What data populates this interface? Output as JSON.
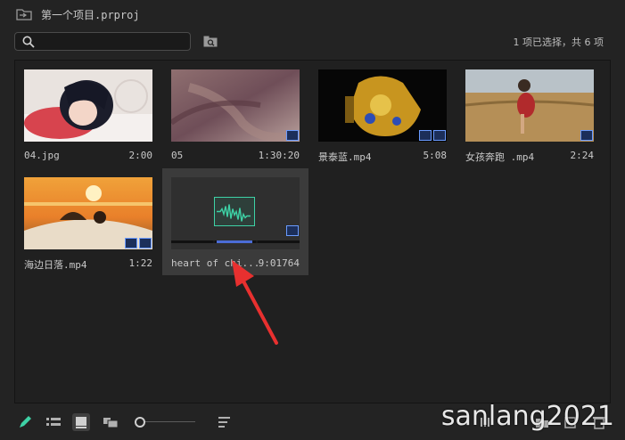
{
  "project": {
    "title": "第一个项目.prproj"
  },
  "search": {
    "placeholder": ""
  },
  "status": {
    "selection": "1 项已选择，共 6 项"
  },
  "items": [
    {
      "name": "04.jpg",
      "duration": "2:00"
    },
    {
      "name": "05",
      "duration": "1:30:20"
    },
    {
      "name": "景泰蓝.mp4",
      "duration": "5:08"
    },
    {
      "name": "女孩奔跑 .mp4",
      "duration": "2:24"
    },
    {
      "name": "海边日落.mp4",
      "duration": "1:22"
    },
    {
      "name": "heart of chi...",
      "duration": "9:01764",
      "selected": true,
      "playhead_progress": 0.63
    }
  ],
  "toolbar": {
    "icons": [
      "pencil-icon",
      "list-view-icon",
      "icon-view-icon",
      "freeform-view-icon",
      "zoom-slider",
      "sort-icon",
      "automate-to-sequence-icon",
      "find-icon",
      "new-bin-icon",
      "new-item-icon",
      "trash-icon"
    ],
    "zoom_level": 0.0
  },
  "watermark": "sanlang2021",
  "colors": {
    "accent": "#4b6cd6",
    "waveform": "#3ed2a6",
    "annotation_arrow": "#e8302f"
  }
}
